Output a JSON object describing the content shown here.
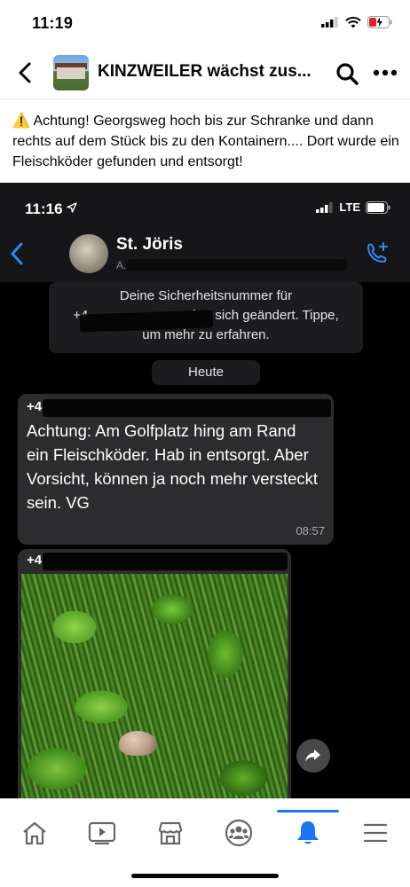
{
  "status_bar": {
    "time": "11:19"
  },
  "header": {
    "title": "KINZWEILER wächst zus...",
    "search_icon": "search-icon",
    "more_icon": "more-horizontal-icon"
  },
  "post": {
    "warning_emoji": "⚠️",
    "text": "Achtung! Georgsweg hoch bis zur Schranke und dann rechts auf dem Stück bis zu den Kontainern.... Dort wurde ein Fleischköder gefunden und entsorgt!"
  },
  "screenshot": {
    "status_time": "11:16",
    "network": "LTE",
    "chat_name": "St. Jöris",
    "chat_subtitle": "A...",
    "security_notice": {
      "line1": "Deine Sicherheitsnummer für",
      "line2_prefix": "+4",
      "line2_suffix": "hat sich geändert. Tippe,",
      "line3": "um mehr zu erfahren."
    },
    "date_label": "Heute",
    "message": {
      "sender": "+4",
      "text": "Achtung: Am Golfplatz hing am Rand ein Fleischköder. Hab in entsorgt. Aber Vorsicht, können ja noch mehr versteckt sein. VG",
      "time": "08:57"
    },
    "image_message": {
      "sender": "+4"
    }
  },
  "tabbar": {
    "items": [
      "home-icon",
      "video-icon",
      "marketplace-icon",
      "groups-icon",
      "notifications-icon",
      "menu-icon"
    ],
    "active": "notifications-icon",
    "accent": "#1877f2"
  }
}
